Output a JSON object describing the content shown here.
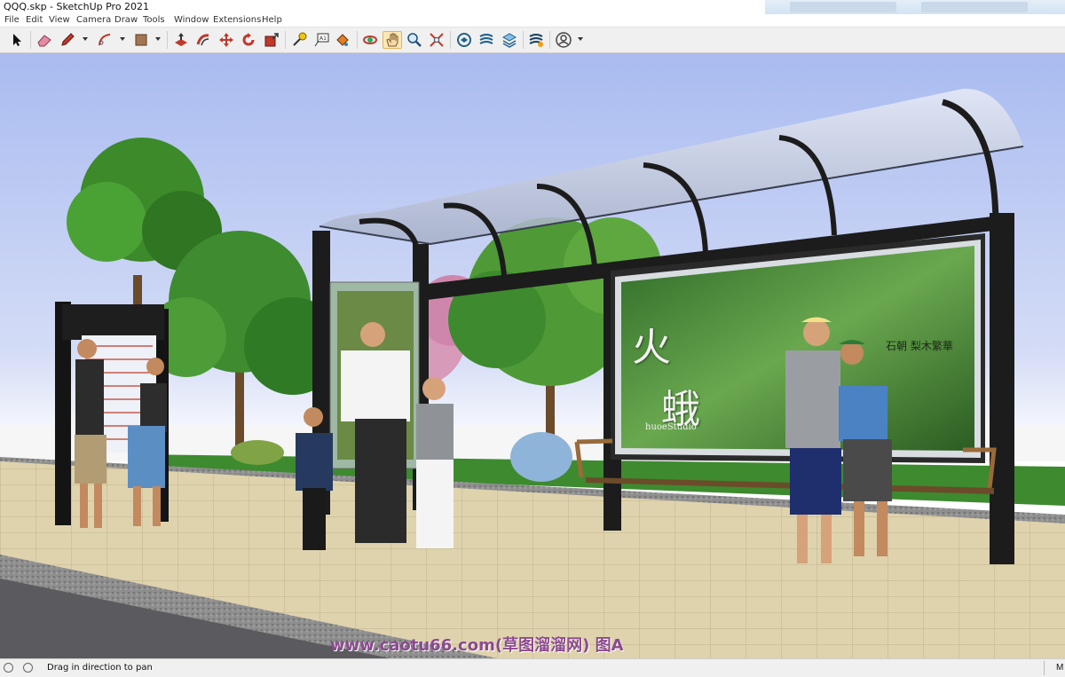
{
  "window": {
    "title": "QQQ.skp - SketchUp Pro 2021"
  },
  "menu": [
    "File",
    "Edit",
    "View",
    "Camera",
    "Draw",
    "Tools",
    "Window",
    "Extensions",
    "Help"
  ],
  "toolbar": {
    "tools": [
      {
        "name": "select-tool",
        "icon": "arrow-cursor-icon"
      },
      {
        "name": "eraser-tool",
        "icon": "eraser-icon"
      },
      {
        "name": "line-tool",
        "icon": "pencil-icon",
        "dropdown": true
      },
      {
        "name": "arc-tool",
        "icon": "arc-icon",
        "dropdown": true
      },
      {
        "name": "shape-tool",
        "icon": "rectangle-icon",
        "dropdown": true
      },
      {
        "name": "push-pull-tool",
        "icon": "push-pull-icon"
      },
      {
        "name": "offset-tool",
        "icon": "offset-icon"
      },
      {
        "name": "move-tool",
        "icon": "move-arrows-icon"
      },
      {
        "name": "rotate-tool",
        "icon": "rotate-icon"
      },
      {
        "name": "scale-tool",
        "icon": "scale-icon"
      },
      {
        "name": "tape-measure-tool",
        "icon": "tape-measure-icon"
      },
      {
        "name": "text-tool",
        "icon": "text-a1-icon"
      },
      {
        "name": "paint-bucket-tool",
        "icon": "paint-bucket-icon"
      },
      {
        "name": "orbit-tool",
        "icon": "orbit-icon"
      },
      {
        "name": "pan-tool",
        "icon": "hand-icon",
        "active": true
      },
      {
        "name": "zoom-tool",
        "icon": "magnifier-icon"
      },
      {
        "name": "zoom-extents-tool",
        "icon": "zoom-extents-icon"
      },
      {
        "name": "3d-warehouse-tool",
        "icon": "warehouse-icon"
      },
      {
        "name": "extension-warehouse-tool",
        "icon": "extension-warehouse-icon"
      },
      {
        "name": "layout-tool",
        "icon": "layers-icon"
      },
      {
        "name": "extension-manager-tool",
        "icon": "extension-manager-icon"
      },
      {
        "name": "account-tool",
        "icon": "user-circle-icon",
        "dropdown": true
      }
    ]
  },
  "scene": {
    "billboard_char_1": "火",
    "billboard_char_2": "蛾",
    "billboard_studio": "huoeStudio",
    "billboard_side_text": "石朝   梨木繁華",
    "colors": {
      "sky": "#b3c4f2",
      "billboard": "#3f7a34",
      "shelter_frame": "#1c1c1c",
      "pavement": "#ddd0a8",
      "grass": "#3d8a2f"
    }
  },
  "watermark": "www.caotu66.com(草图溜溜网) 图A",
  "status": {
    "message": "Drag in direction to pan",
    "right_label": "M"
  }
}
